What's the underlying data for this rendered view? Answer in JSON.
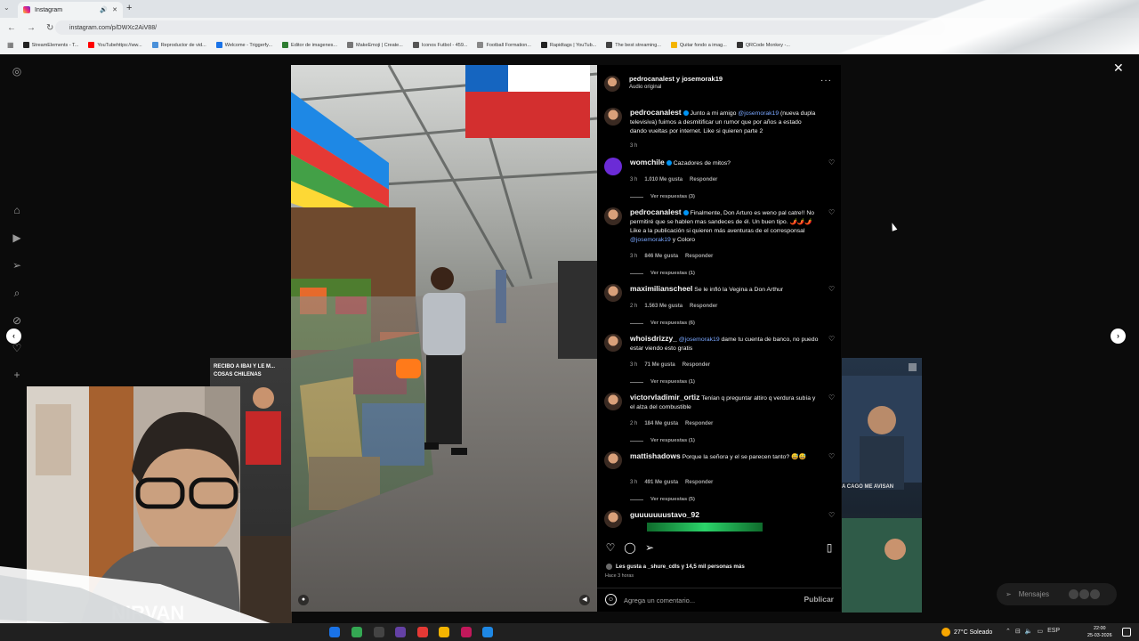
{
  "browser": {
    "tab_title": "Instagram",
    "url": "instagram.com/p/DWXc2AiV88/",
    "bookmarks": [
      {
        "label": "StreamElements - T...",
        "color": "#222222"
      },
      {
        "label": "YouTubehttps://ww...",
        "color": "#ff0000"
      },
      {
        "label": "Reproductor de vid...",
        "color": "#4a90d9"
      },
      {
        "label": "Welcome - Triggerfy...",
        "color": "#1a73e8"
      },
      {
        "label": "Editor de imagenes...",
        "color": "#2e7d32"
      },
      {
        "label": "MakeEmoji | Create...",
        "color": "#777777"
      },
      {
        "label": "Iconos Futbol - 459...",
        "color": "#555555"
      },
      {
        "label": "Football Formation...",
        "color": "#888888"
      },
      {
        "label": "Rapidtags | YouTub...",
        "color": "#222222"
      },
      {
        "label": "The best streaming...",
        "color": "#444444"
      },
      {
        "label": "Quitar fondo a imag...",
        "color": "#f4b400"
      },
      {
        "label": "QRCode Monkey -...",
        "color": "#333333"
      }
    ]
  },
  "post": {
    "authors": "pedrocanalest y josemorak19",
    "audio": "Audio original",
    "comments": [
      {
        "user": "pedrocanalest",
        "verified": true,
        "text_before": "Junto a mi amigo ",
        "mention": "@josemorak19",
        "text_after": " (nueva dupla televisiva) fuimos a desmitificar un rumor que por años a estado dando vueltas por internet. Like si quieren parte 2",
        "time": "3 h",
        "likes": "",
        "reply": "",
        "view_replies": "",
        "caption": true
      },
      {
        "user": "womchile",
        "verified": true,
        "text_before": "Cazadores de mitos?",
        "mention": "",
        "text_after": "",
        "time": "3 h",
        "likes": "1.010 Me gusta",
        "reply": "Responder",
        "view_replies": "Ver respuestas (3)"
      },
      {
        "user": "pedrocanalest",
        "verified": true,
        "text_before": "Finalmente, Don Arturo es weno pal catre!! No permitiré que se hablen mas sandeces de él. Un buen tipo. 🌶️🌶️🌶️ Like a la publicación si quieren más aventuras de el corresponsal ",
        "mention": "@josemorak19",
        "text_after": " y Coloro",
        "time": "3 h",
        "likes": "846 Me gusta",
        "reply": "Responder",
        "view_replies": "Ver respuestas (1)"
      },
      {
        "user": "maximilianscheel",
        "verified": false,
        "text_before": "Se le infló la Vegina a Don Arthur",
        "mention": "",
        "text_after": "",
        "time": "2 h",
        "likes": "1.563 Me gusta",
        "reply": "Responder",
        "view_replies": "Ver respuestas (6)"
      },
      {
        "user": "whoisdrizzy_",
        "verified": false,
        "text_before": "",
        "mention": "@josemorak19",
        "text_after": " dame tu cuenta de banco, no puedo estar viendo esto gratis",
        "time": "3 h",
        "likes": "71 Me gusta",
        "reply": "Responder",
        "view_replies": "Ver respuestas (1)"
      },
      {
        "user": "victorvladimir_ortiz",
        "verified": false,
        "text_before": "Tenían q preguntar altiro q verdura subía y el alza del combustible",
        "mention": "",
        "text_after": "",
        "time": "2 h",
        "likes": "184 Me gusta",
        "reply": "Responder",
        "view_replies": "Ver respuestas (1)"
      },
      {
        "user": "mattishadows",
        "verified": false,
        "text_before": "Porque la señora y el se parecen tanto? 😅😅",
        "mention": "",
        "text_after": "",
        "time": "3 h",
        "likes": "491 Me gusta",
        "reply": "Responder",
        "view_replies": "Ver respuestas (5)"
      },
      {
        "user": "guuuuuuustavo_92",
        "verified": false,
        "text_before": "",
        "mention": "",
        "text_after": "",
        "time": "",
        "likes": "",
        "reply": "",
        "view_replies": ""
      }
    ],
    "likes_line": "Les gusta a _shure_cdls y 14,5 mil personas más",
    "posted_ago": "Hace 3 horas",
    "comment_placeholder": "Agrega un comentario...",
    "publish_label": "Publicar"
  },
  "background": {
    "left_caption": "RECIBO A IBAI Y LE M... COSAS CHILENAS",
    "right_caption": "A CAGO ME AVISAN"
  },
  "messages": {
    "label": "Mensajes"
  },
  "taskbar": {
    "weather": "27°C Soleado",
    "lang": "ESP",
    "time": "22:00",
    "date": "25-03-2026"
  },
  "webcam": {
    "shirt_text": "NIRVAN"
  },
  "colors": {
    "accent_blue": "#0095f6",
    "mention": "#7aa7ff"
  }
}
